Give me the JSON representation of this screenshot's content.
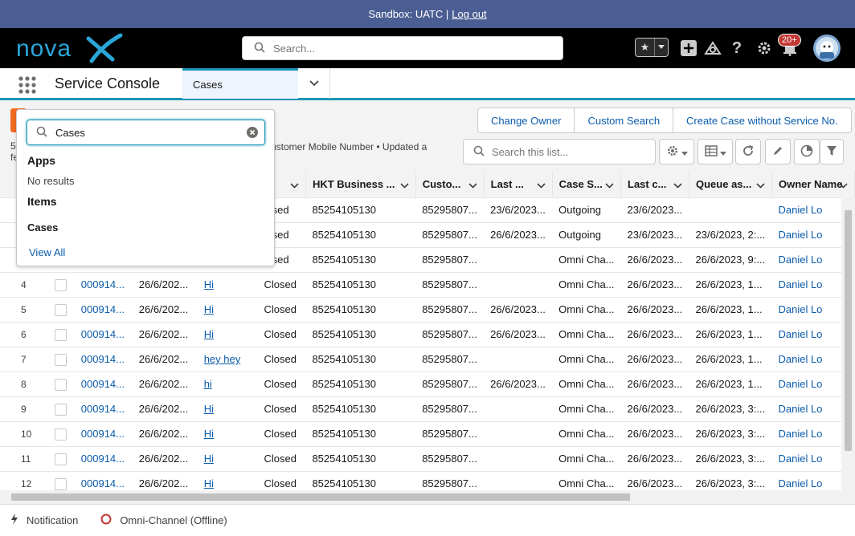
{
  "sandbox": {
    "text": "Sandbox: UATC |",
    "logout": "Log out"
  },
  "header": {
    "logo_text": "novaX",
    "search_placeholder": "Search...",
    "notification_count": "20+"
  },
  "nav": {
    "app_name": "Service Console",
    "tab_label": "Cases"
  },
  "list": {
    "meta_left_1": "5",
    "meta_left_2": "fe",
    "meta_text": "ustomer Mobile Number • Updated a",
    "buttons": [
      "Change Owner",
      "Custom Search",
      "Create Case without Service No."
    ],
    "search_placeholder": "Search this list..."
  },
  "table": {
    "columns": [
      "...",
      "HKT Business ...",
      "Custo...",
      "Last ...",
      "Case S...",
      "Last c...",
      "Queue as...",
      "Owner Name"
    ],
    "rows": [
      {
        "num": "",
        "case": "",
        "date": "",
        "subject": "",
        "status": "losed",
        "biz": "85254105130",
        "cust": "85295807...",
        "last": "23/6/2023...",
        "source": "Outgoing",
        "lastc": "23/6/2023...",
        "queue": "",
        "owner": "Daniel Lo"
      },
      {
        "num": "",
        "case": "",
        "date": "",
        "subject": "",
        "status": "losed",
        "biz": "85254105130",
        "cust": "85295807...",
        "last": "26/6/2023...",
        "source": "Outgoing",
        "lastc": "23/6/2023...",
        "queue": "23/6/2023, 2:...",
        "owner": "Daniel Lo"
      },
      {
        "num": "",
        "case": "",
        "date": "",
        "subject": "",
        "status": "losed",
        "biz": "85254105130",
        "cust": "85295807...",
        "last": "",
        "source": "Omni Cha...",
        "lastc": "26/6/2023...",
        "queue": "26/6/2023, 9:...",
        "owner": "Daniel Lo"
      },
      {
        "num": "4",
        "case": "000914...",
        "date": "26/6/202...",
        "subject": "Hi",
        "status": "Closed",
        "biz": "85254105130",
        "cust": "85295807...",
        "last": "",
        "source": "Omni Cha...",
        "lastc": "26/6/2023...",
        "queue": "26/6/2023, 1...",
        "owner": "Daniel Lo"
      },
      {
        "num": "5",
        "case": "000914...",
        "date": "26/6/202...",
        "subject": "Hi",
        "status": "Closed",
        "biz": "85254105130",
        "cust": "85295807...",
        "last": "26/6/2023...",
        "source": "Omni Cha...",
        "lastc": "26/6/2023...",
        "queue": "26/6/2023, 1...",
        "owner": "Daniel Lo"
      },
      {
        "num": "6",
        "case": "000914...",
        "date": "26/6/202...",
        "subject": "Hi",
        "status": "Closed",
        "biz": "85254105130",
        "cust": "85295807...",
        "last": "26/6/2023...",
        "source": "Omni Cha...",
        "lastc": "26/6/2023...",
        "queue": "26/6/2023, 1...",
        "owner": "Daniel Lo"
      },
      {
        "num": "7",
        "case": "000914...",
        "date": "26/6/202...",
        "subject": "hey hey",
        "status": "Closed",
        "biz": "85254105130",
        "cust": "85295807...",
        "last": "",
        "source": "Omni Cha...",
        "lastc": "26/6/2023...",
        "queue": "26/6/2023, 1...",
        "owner": "Daniel Lo"
      },
      {
        "num": "8",
        "case": "000914...",
        "date": "26/6/202...",
        "subject": "hi",
        "status": "Closed",
        "biz": "85254105130",
        "cust": "85295807...",
        "last": "26/6/2023...",
        "source": "Omni Cha...",
        "lastc": "26/6/2023...",
        "queue": "26/6/2023, 1...",
        "owner": "Daniel Lo"
      },
      {
        "num": "9",
        "case": "000914...",
        "date": "26/6/202...",
        "subject": "Hi",
        "status": "Closed",
        "biz": "85254105130",
        "cust": "85295807...",
        "last": "",
        "source": "Omni Cha...",
        "lastc": "26/6/2023...",
        "queue": "26/6/2023, 3:...",
        "owner": "Daniel Lo"
      },
      {
        "num": "10",
        "case": "000914...",
        "date": "26/6/202...",
        "subject": "Hi",
        "status": "Closed",
        "biz": "85254105130",
        "cust": "85295807...",
        "last": "",
        "source": "Omni Cha...",
        "lastc": "26/6/2023...",
        "queue": "26/6/2023, 3:...",
        "owner": "Daniel Lo"
      },
      {
        "num": "11",
        "case": "000914...",
        "date": "26/6/202...",
        "subject": "Hi",
        "status": "Closed",
        "biz": "85254105130",
        "cust": "85295807...",
        "last": "",
        "source": "Omni Cha...",
        "lastc": "26/6/2023...",
        "queue": "26/6/2023, 3:...",
        "owner": "Daniel Lo"
      },
      {
        "num": "12",
        "case": "000914...",
        "date": "26/6/202...",
        "subject": "Hi",
        "status": "Closed",
        "biz": "85254105130",
        "cust": "85295807...",
        "last": "",
        "source": "Omni Cha...",
        "lastc": "26/6/2023...",
        "queue": "26/6/2023, 3:...",
        "owner": "Daniel Lo"
      }
    ]
  },
  "dropdown": {
    "input_value": "Cases",
    "apps_heading": "Apps",
    "no_results": "No results",
    "items_heading": "Items",
    "cases_heading": "Cases",
    "view_all": "View All"
  },
  "utility": {
    "notification": "Notification",
    "omni": "Omni-Channel (Offline)"
  },
  "colors": {
    "sandbox_bar": "#4b5e93",
    "accent": "#1b96b5",
    "link": "#0b5cab",
    "badge": "#c23934",
    "orange": "#f26a21"
  },
  "icons": [
    "search-icon",
    "star-icon",
    "plus-icon",
    "trailhead-icon",
    "help-icon",
    "gear-icon",
    "bell-icon",
    "app-launcher-icon",
    "chevron-down-icon",
    "clear-icon",
    "refresh-icon",
    "edit-icon",
    "chart-icon",
    "filter-icon",
    "table-icon",
    "lightning-icon",
    "omni-status-icon"
  ]
}
